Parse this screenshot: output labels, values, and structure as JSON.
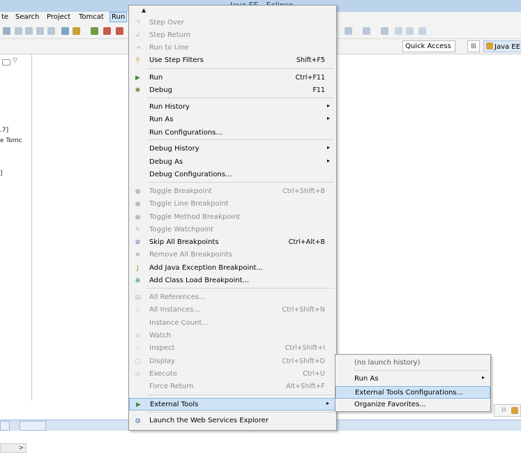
{
  "window": {
    "title": "Java EE - Eclipse"
  },
  "menubar": {
    "items": [
      "te",
      "Search",
      "Project",
      "Tomcat",
      "Run"
    ],
    "active": "Run"
  },
  "toolbar": {
    "quick_access": "Quick Access",
    "perspective": "Java EE"
  },
  "left_panel": {
    "lines": [
      ".7]",
      "e Tomc",
      "]"
    ],
    "scroll_arrow": ">"
  },
  "run_menu": {
    "scroll_up": "▲",
    "items": [
      {
        "label": "Step Over",
        "shortcut": "",
        "icon": "step-over-icon",
        "enabled": false
      },
      {
        "label": "Step Return",
        "shortcut": "",
        "icon": "step-return-icon",
        "enabled": false
      },
      {
        "label": "Run to Line",
        "shortcut": "",
        "icon": "run-to-line-icon",
        "enabled": false
      },
      {
        "label": "Use Step Filters",
        "shortcut": "Shift+F5",
        "icon": "step-filters-icon",
        "enabled": true
      },
      {
        "label": "Run",
        "shortcut": "Ctrl+F11",
        "icon": "run-icon",
        "enabled": true
      },
      {
        "label": "Debug",
        "shortcut": "F11",
        "icon": "debug-icon",
        "enabled": true
      },
      {
        "label": "Run History",
        "shortcut": "",
        "icon": "",
        "enabled": true,
        "submenu": true
      },
      {
        "label": "Run As",
        "shortcut": "",
        "icon": "",
        "enabled": true,
        "submenu": true
      },
      {
        "label": "Run Configurations...",
        "shortcut": "",
        "icon": "",
        "enabled": true
      },
      {
        "label": "Debug History",
        "shortcut": "",
        "icon": "",
        "enabled": true,
        "submenu": true
      },
      {
        "label": "Debug As",
        "shortcut": "",
        "icon": "",
        "enabled": true,
        "submenu": true
      },
      {
        "label": "Debug Configurations...",
        "shortcut": "",
        "icon": "",
        "enabled": true
      },
      {
        "label": "Toggle Breakpoint",
        "shortcut": "Ctrl+Shift+B",
        "icon": "breakpoint-dot-icon",
        "enabled": false
      },
      {
        "label": "Toggle Line Breakpoint",
        "shortcut": "",
        "icon": "breakpoint-dot-icon",
        "enabled": false
      },
      {
        "label": "Toggle Method Breakpoint",
        "shortcut": "",
        "icon": "breakpoint-dot-icon",
        "enabled": false
      },
      {
        "label": "Toggle Watchpoint",
        "shortcut": "",
        "icon": "watchpoint-icon",
        "enabled": false
      },
      {
        "label": "Skip All Breakpoints",
        "shortcut": "Ctrl+Alt+B",
        "icon": "skip-breakpoints-icon",
        "enabled": true
      },
      {
        "label": "Remove All Breakpoints",
        "shortcut": "",
        "icon": "remove-breakpoints-icon",
        "enabled": false
      },
      {
        "label": "Add Java Exception Breakpoint...",
        "shortcut": "",
        "icon": "exception-breakpoint-icon",
        "enabled": true
      },
      {
        "label": "Add Class Load Breakpoint...",
        "shortcut": "",
        "icon": "class-load-icon",
        "enabled": true
      },
      {
        "label": "All References...",
        "shortcut": "",
        "icon": "references-icon",
        "enabled": false
      },
      {
        "label": "All Instances...",
        "shortcut": "Ctrl+Shift+N",
        "icon": "instances-icon",
        "enabled": false
      },
      {
        "label": "Instance Count...",
        "shortcut": "",
        "icon": "",
        "enabled": false
      },
      {
        "label": "Watch",
        "shortcut": "",
        "icon": "watch-icon",
        "enabled": false
      },
      {
        "label": "Inspect",
        "shortcut": "Ctrl+Shift+I",
        "icon": "inspect-icon",
        "enabled": false
      },
      {
        "label": "Display",
        "shortcut": "Ctrl+Shift+D",
        "icon": "display-icon",
        "enabled": false
      },
      {
        "label": "Execute",
        "shortcut": "Ctrl+U",
        "icon": "execute-icon",
        "enabled": false
      },
      {
        "label": "Force Return",
        "shortcut": "Alt+Shift+F",
        "icon": "",
        "enabled": false
      },
      {
        "label": "External Tools",
        "shortcut": "",
        "icon": "external-tools-icon",
        "enabled": true,
        "submenu": true,
        "highlighted": true
      },
      {
        "label": "Launch the Web Services Explorer",
        "shortcut": "",
        "icon": "web-services-icon",
        "enabled": true
      }
    ]
  },
  "external_tools_submenu": {
    "items": [
      {
        "label": "(no launch history)",
        "enabled": false
      },
      {
        "label": "Run As",
        "enabled": true,
        "submenu": true
      },
      {
        "label": "External Tools Configurations...",
        "enabled": true,
        "highlighted": true
      },
      {
        "label": "Organize Favorites...",
        "enabled": true
      }
    ]
  },
  "colors": {
    "title_bar": "#bcd3ec",
    "menu_bg": "#f2f2f2",
    "highlight": "#cfe3f7",
    "highlight_border": "#88b3e0",
    "disabled_text": "#8c8c8c"
  }
}
